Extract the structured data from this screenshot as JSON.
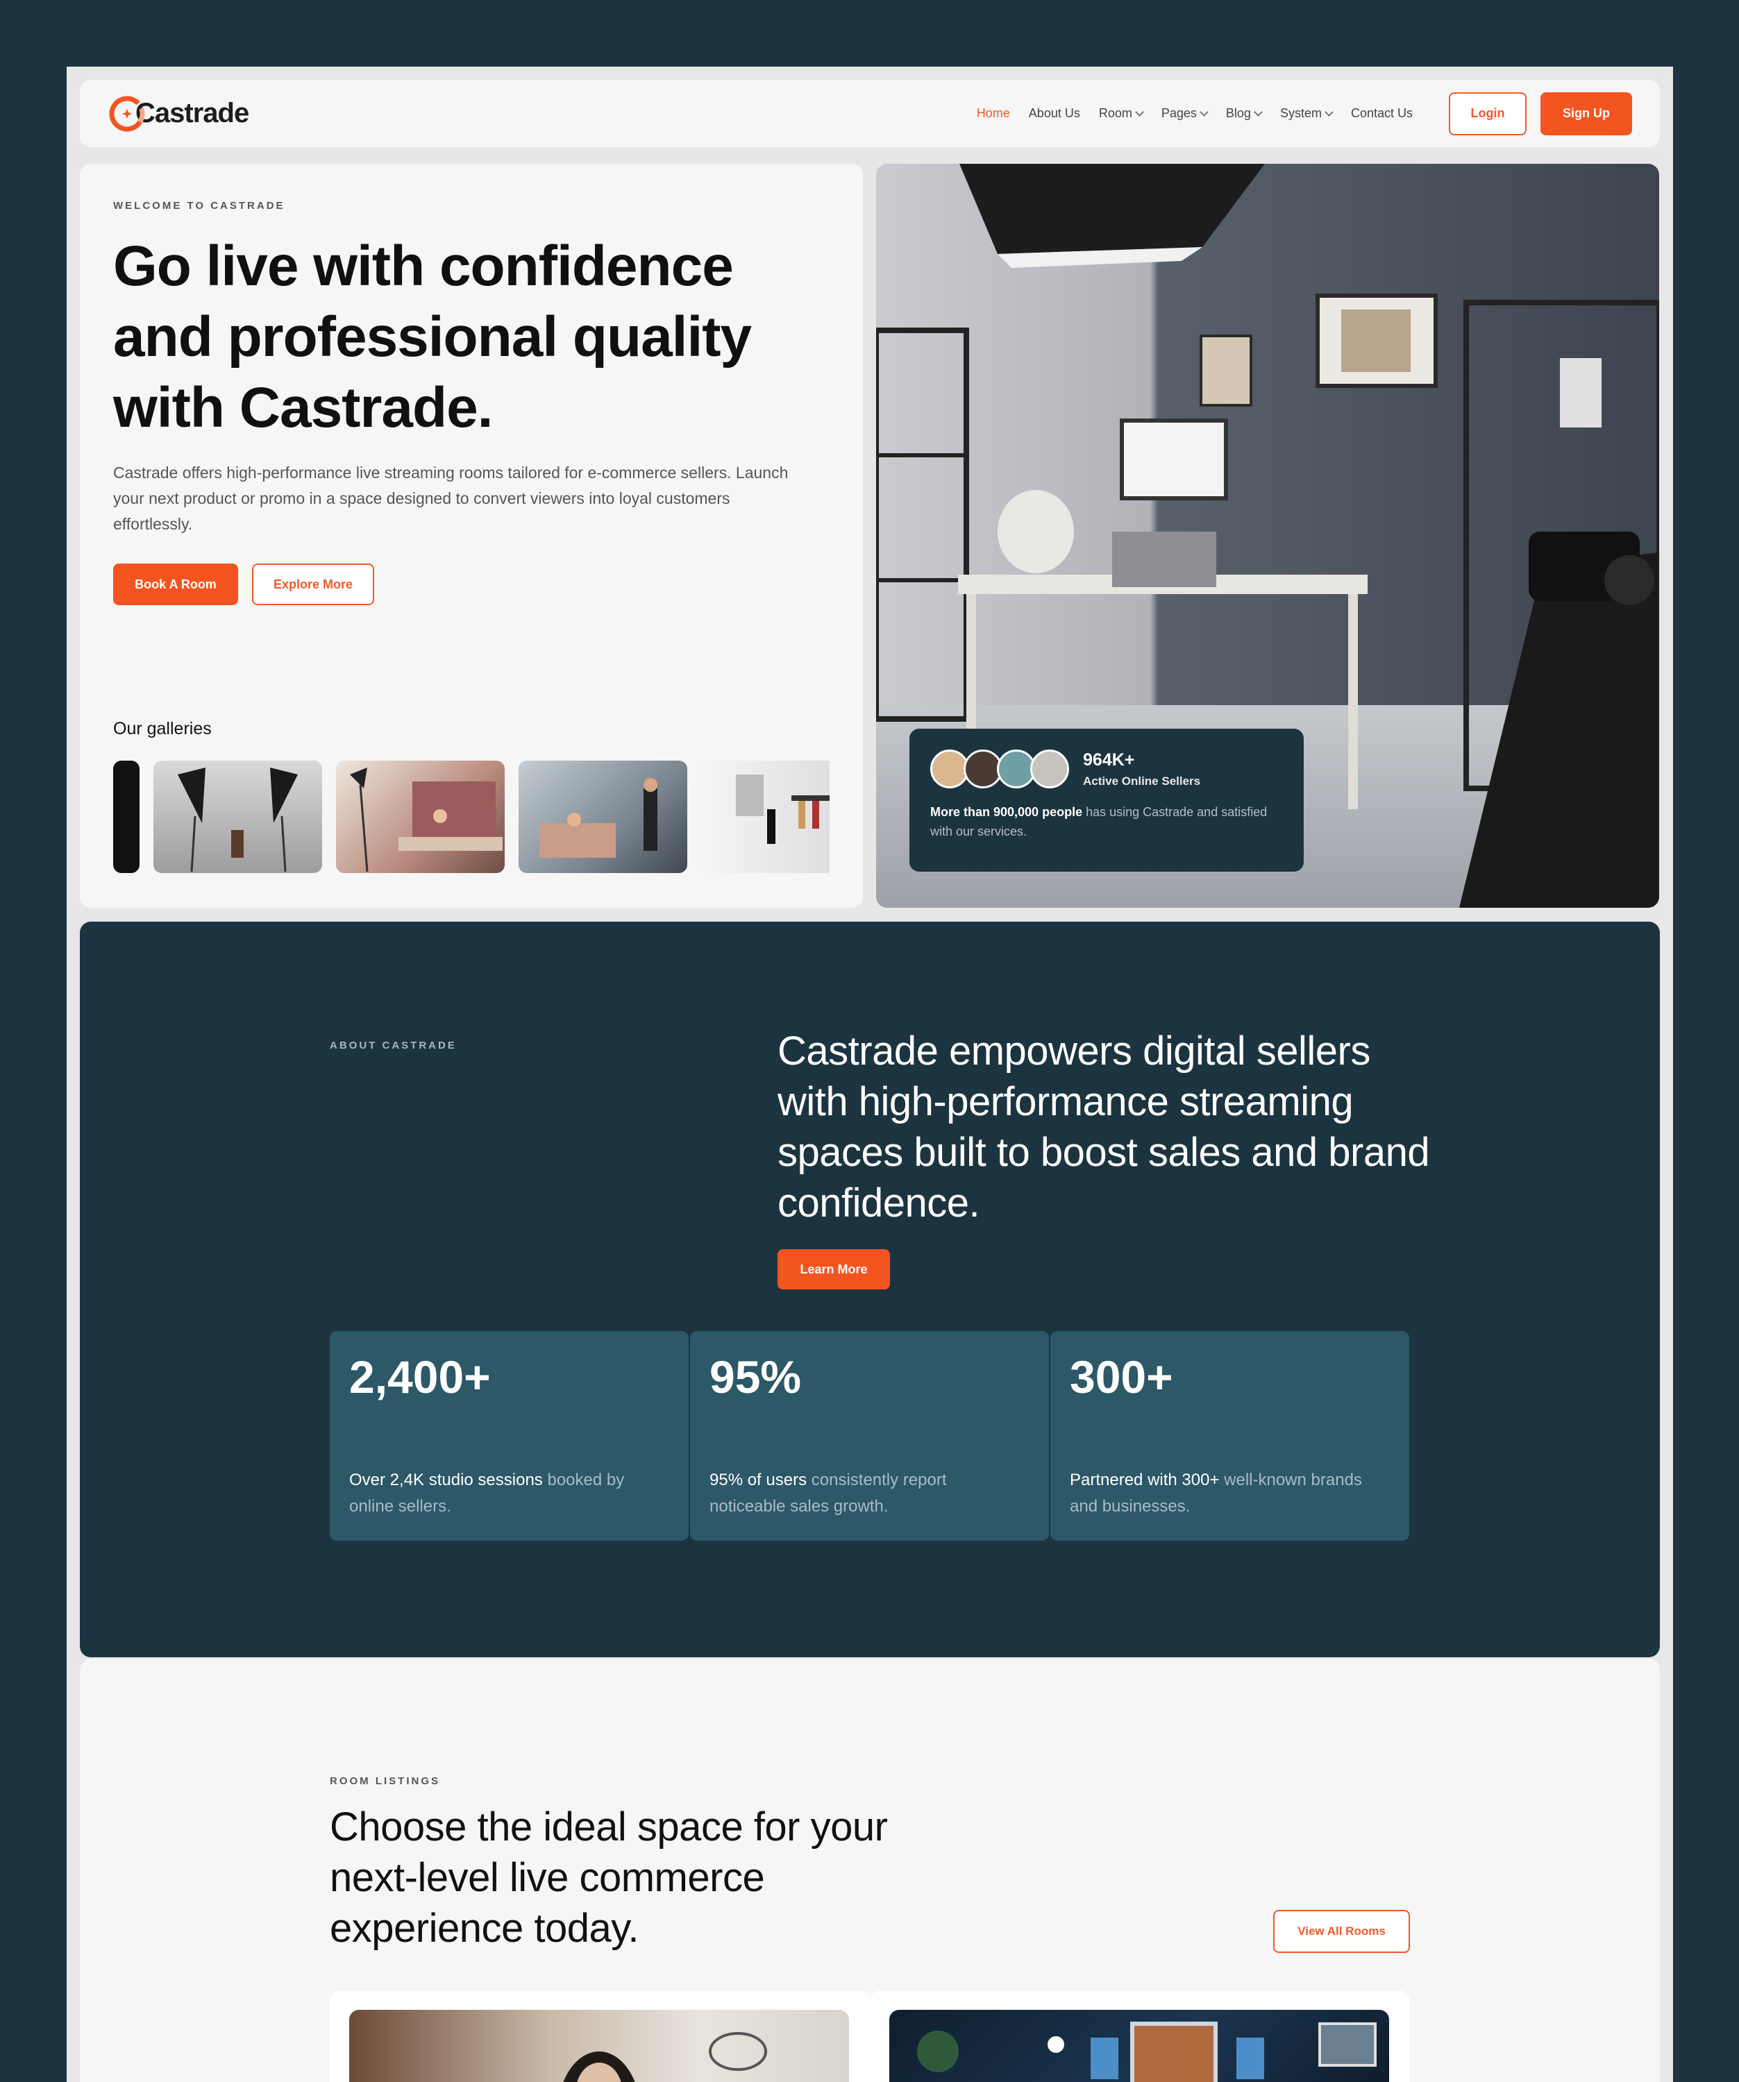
{
  "nav": {
    "brand": "Castrade",
    "menu": [
      {
        "label": "Home",
        "active": true,
        "dropdown": false
      },
      {
        "label": "About Us",
        "active": false,
        "dropdown": false
      },
      {
        "label": "Room",
        "active": false,
        "dropdown": true
      },
      {
        "label": "Pages",
        "active": false,
        "dropdown": true
      },
      {
        "label": "Blog",
        "active": false,
        "dropdown": true
      },
      {
        "label": "System",
        "active": false,
        "dropdown": true
      },
      {
        "label": "Contact Us",
        "active": false,
        "dropdown": false
      }
    ],
    "login": "Login",
    "signup": "Sign Up"
  },
  "hero": {
    "eyebrow": "WELCOME TO CASTRADE",
    "title": "Go live with confidence and professional quality with Castrade.",
    "description": "Castrade offers high-performance live streaming rooms tailored for e-commerce sellers. Launch your next product or promo in a space designed to convert viewers into loyal customers effortlessly.",
    "book_button": "Book A Room",
    "explore_button": "Explore More",
    "galleries_label": "Our galleries"
  },
  "stat_card": {
    "number": "964K+",
    "label": "Active Online Sellers",
    "desc_bold": "More than 900,000 people",
    "desc_rest": " has using Castrade and satisfied with our services."
  },
  "about": {
    "eyebrow": "ABOUT CASTRADE",
    "title": "Castrade empowers digital sellers with high-performance streaming spaces built to boost sales and brand confidence.",
    "learn_more": "Learn More",
    "stats": [
      {
        "number": "2,400+",
        "bold": "Over 2,4K studio sessions",
        "rest": " booked by online sellers."
      },
      {
        "number": "95%",
        "bold": "95% of users",
        "rest": " consistently report noticeable sales growth."
      },
      {
        "number": "300+",
        "bold": "Partnered with 300+",
        "rest": " well-known brands and businesses."
      }
    ]
  },
  "rooms": {
    "eyebrow": "ROOM LISTINGS",
    "title": "Choose the ideal space for your next-level live commerce experience today.",
    "view_all": "View All Rooms"
  },
  "colors": {
    "accent": "#f4541f",
    "dark": "#1c3440",
    "stat_box": "#2c5868",
    "panel": "#f6f6f6"
  }
}
